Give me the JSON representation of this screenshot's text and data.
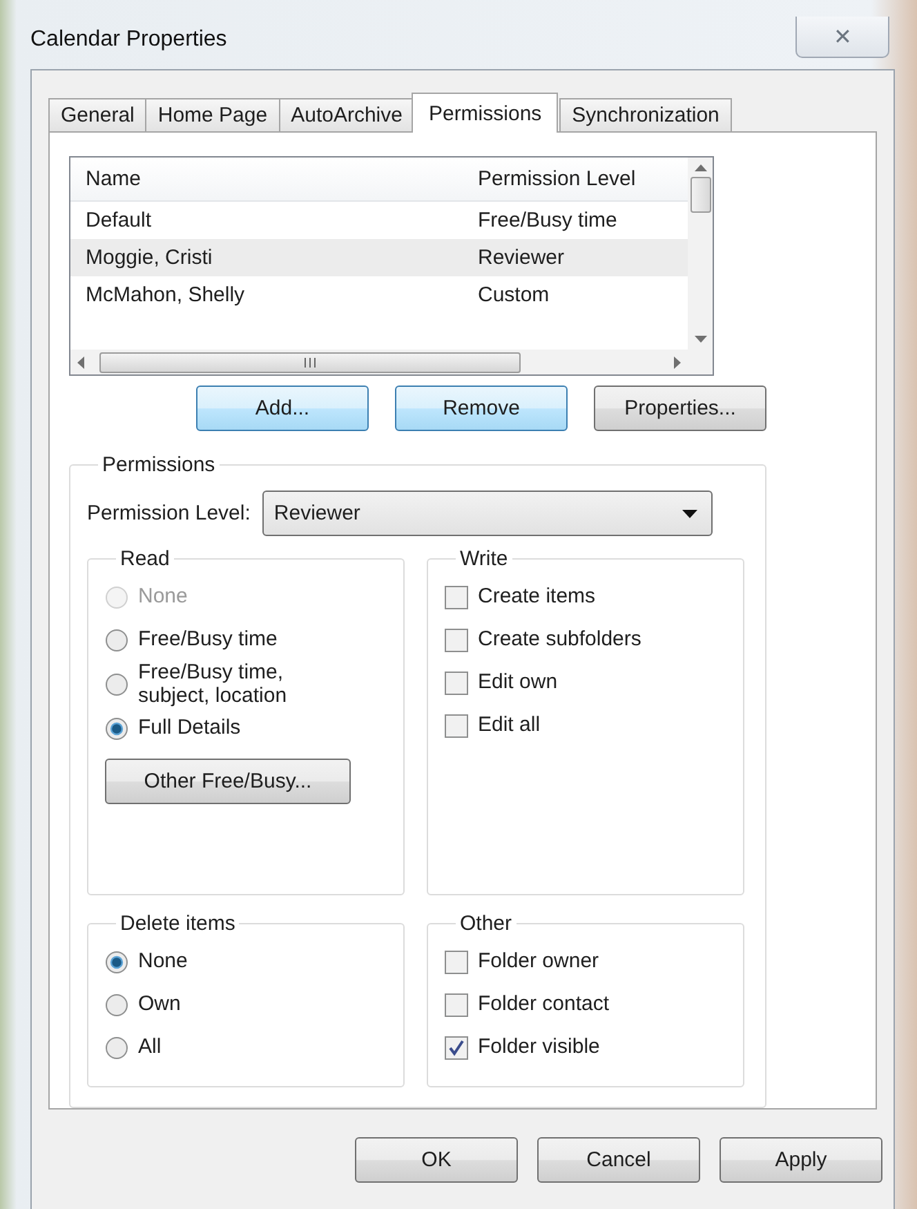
{
  "window": {
    "title": "Calendar Properties",
    "close": "✕"
  },
  "tabs": [
    {
      "label": "General",
      "selected": false
    },
    {
      "label": "Home Page",
      "selected": false
    },
    {
      "label": "AutoArchive",
      "selected": false
    },
    {
      "label": "Permissions",
      "selected": true
    },
    {
      "label": "Synchronization",
      "selected": false
    }
  ],
  "permissions_list": {
    "columns": [
      "Name",
      "Permission Level"
    ],
    "rows": [
      {
        "name": "Default",
        "level": "Free/Busy time",
        "selected": false
      },
      {
        "name": "Moggie, Cristi",
        "level": "Reviewer",
        "selected": true
      },
      {
        "name": "McMahon, Shelly",
        "level": "Custom",
        "selected": false
      }
    ]
  },
  "list_buttons": [
    {
      "label": "Add...",
      "highlighted": true
    },
    {
      "label": "Remove",
      "highlighted": true
    },
    {
      "label": "Properties...",
      "highlighted": false
    }
  ],
  "permissions": {
    "title": "Permissions",
    "level_label": "Permission Level:",
    "level_value": "Reviewer",
    "read": {
      "title": "Read",
      "options": [
        {
          "label": "None",
          "selected": false,
          "disabled": true
        },
        {
          "label": "Free/Busy time",
          "selected": false,
          "disabled": false
        },
        {
          "label": "Free/Busy time, subject, location",
          "selected": false,
          "disabled": false
        },
        {
          "label": "Full Details",
          "selected": true,
          "disabled": false
        }
      ],
      "button": "Other Free/Busy..."
    },
    "write": {
      "title": "Write",
      "items": [
        {
          "label": "Create items",
          "checked": false
        },
        {
          "label": "Create subfolders",
          "checked": false
        },
        {
          "label": "Edit own",
          "checked": false
        },
        {
          "label": "Edit all",
          "checked": false
        }
      ]
    },
    "delete": {
      "title": "Delete items",
      "options": [
        {
          "label": "None",
          "selected": true,
          "disabled": false
        },
        {
          "label": "Own",
          "selected": false,
          "disabled": false
        },
        {
          "label": "All",
          "selected": false,
          "disabled": false
        }
      ]
    },
    "other": {
      "title": "Other",
      "items": [
        {
          "label": "Folder owner",
          "checked": false
        },
        {
          "label": "Folder contact",
          "checked": false
        },
        {
          "label": "Folder visible",
          "checked": true
        }
      ]
    }
  },
  "dialog_buttons": [
    "OK",
    "Cancel",
    "Apply"
  ]
}
